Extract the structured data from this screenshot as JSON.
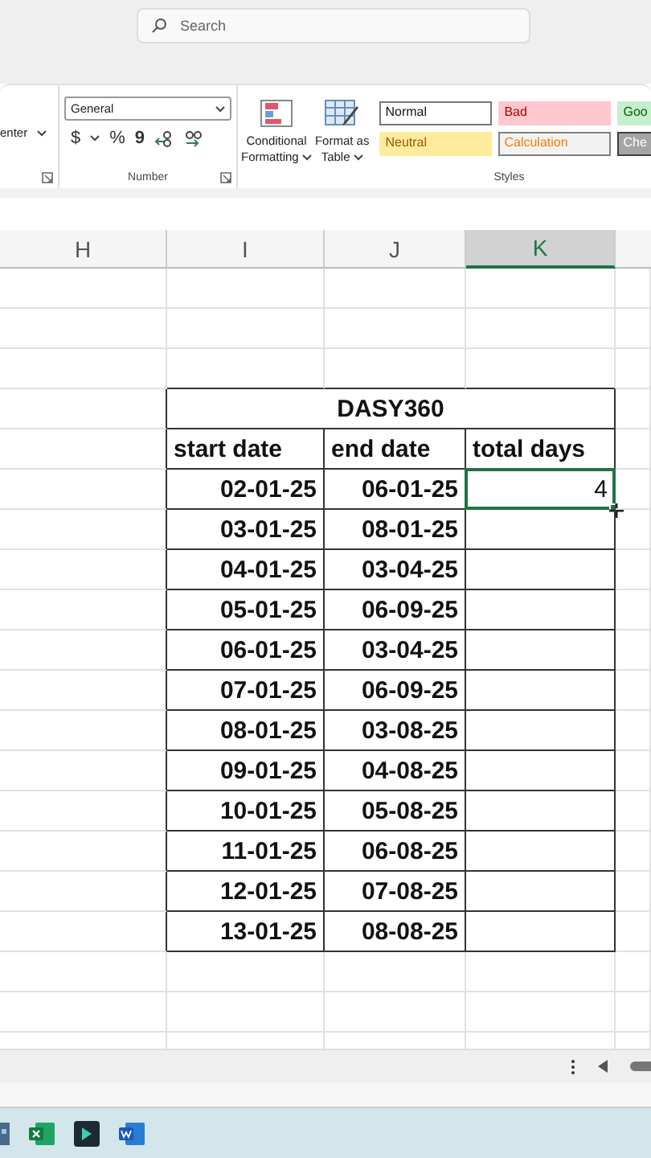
{
  "search": {
    "placeholder": "Search"
  },
  "ribbon": {
    "alignment_partial": "enter",
    "number_format": "General",
    "currency": "$",
    "percent": "%",
    "comma": "9",
    "number_label": "Number",
    "conditional_formatting": [
      "Conditional",
      "Formatting"
    ],
    "format_as_table": [
      "Format as",
      "Table"
    ],
    "styles": [
      {
        "label": "Normal",
        "kind": "normal"
      },
      {
        "label": "Bad",
        "kind": "bad"
      },
      {
        "label": "Goo",
        "kind": "good"
      },
      {
        "label": "Neutral",
        "kind": "neutral"
      },
      {
        "label": "Calculation",
        "kind": "calculation"
      },
      {
        "label": "Che",
        "kind": "check"
      }
    ],
    "styles_label": "Styles"
  },
  "columns": [
    {
      "label": "H",
      "selected": false
    },
    {
      "label": "I",
      "selected": false
    },
    {
      "label": "J",
      "selected": false
    },
    {
      "label": "K",
      "selected": true
    }
  ],
  "table": {
    "title": "DASY360",
    "headers": [
      "start date",
      "end date",
      "total days"
    ],
    "rows": [
      {
        "start": "02-01-25",
        "end": "06-01-25",
        "total": "4",
        "selected": true
      },
      {
        "start": "03-01-25",
        "end": "08-01-25",
        "total": "",
        "selected": false
      },
      {
        "start": "04-01-25",
        "end": "03-04-25",
        "total": "",
        "selected": false
      },
      {
        "start": "05-01-25",
        "end": "06-09-25",
        "total": "",
        "selected": false
      },
      {
        "start": "06-01-25",
        "end": "03-04-25",
        "total": "",
        "selected": false
      },
      {
        "start": "07-01-25",
        "end": "06-09-25",
        "total": "",
        "selected": false
      },
      {
        "start": "08-01-25",
        "end": "03-08-25",
        "total": "",
        "selected": false
      },
      {
        "start": "09-01-25",
        "end": "04-08-25",
        "total": "",
        "selected": false
      },
      {
        "start": "10-01-25",
        "end": "05-08-25",
        "total": "",
        "selected": false
      },
      {
        "start": "11-01-25",
        "end": "06-08-25",
        "total": "",
        "selected": false
      },
      {
        "start": "12-01-25",
        "end": "07-08-25",
        "total": "",
        "selected": false
      },
      {
        "start": "13-01-25",
        "end": "08-08-25",
        "total": "",
        "selected": false
      }
    ]
  }
}
